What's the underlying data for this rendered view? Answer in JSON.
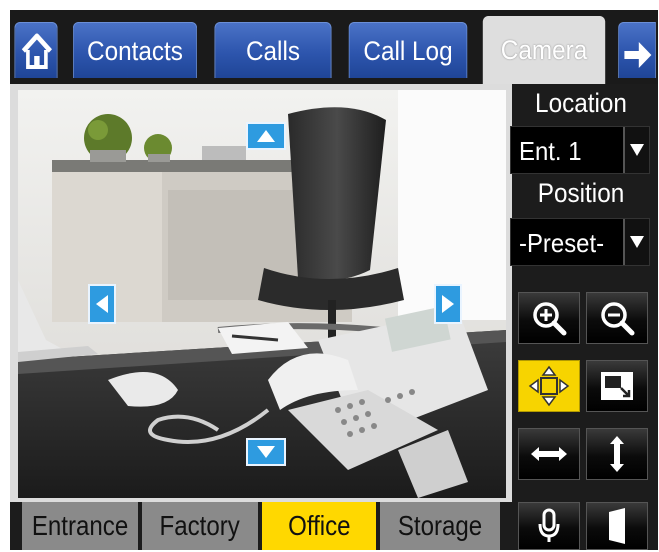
{
  "tabs": {
    "home_icon": "home-icon",
    "contacts": "Contacts",
    "calls": "Calls",
    "call_log": "Call Log",
    "camera": "Camera",
    "next_icon": "arrow-right-icon"
  },
  "controls": {
    "location_label": "Location",
    "location_value": "Ent. 1",
    "position_label": "Position",
    "position_value": "-Preset-",
    "buttons": [
      "zoom-in",
      "zoom-out",
      "pan-tilt",
      "fullscreen",
      "horizontal",
      "vertical",
      "microphone",
      "door"
    ],
    "selected_button": "pan-tilt"
  },
  "locations": {
    "entrance": "Entrance",
    "factory": "Factory",
    "office": "Office",
    "storage": "Storage",
    "selected": "Office"
  },
  "colors": {
    "tab_blue": "#2d55ad",
    "active_tab": "#dedede",
    "highlight_yellow": "#ffd800",
    "arrow_blue": "#2e9be0"
  }
}
